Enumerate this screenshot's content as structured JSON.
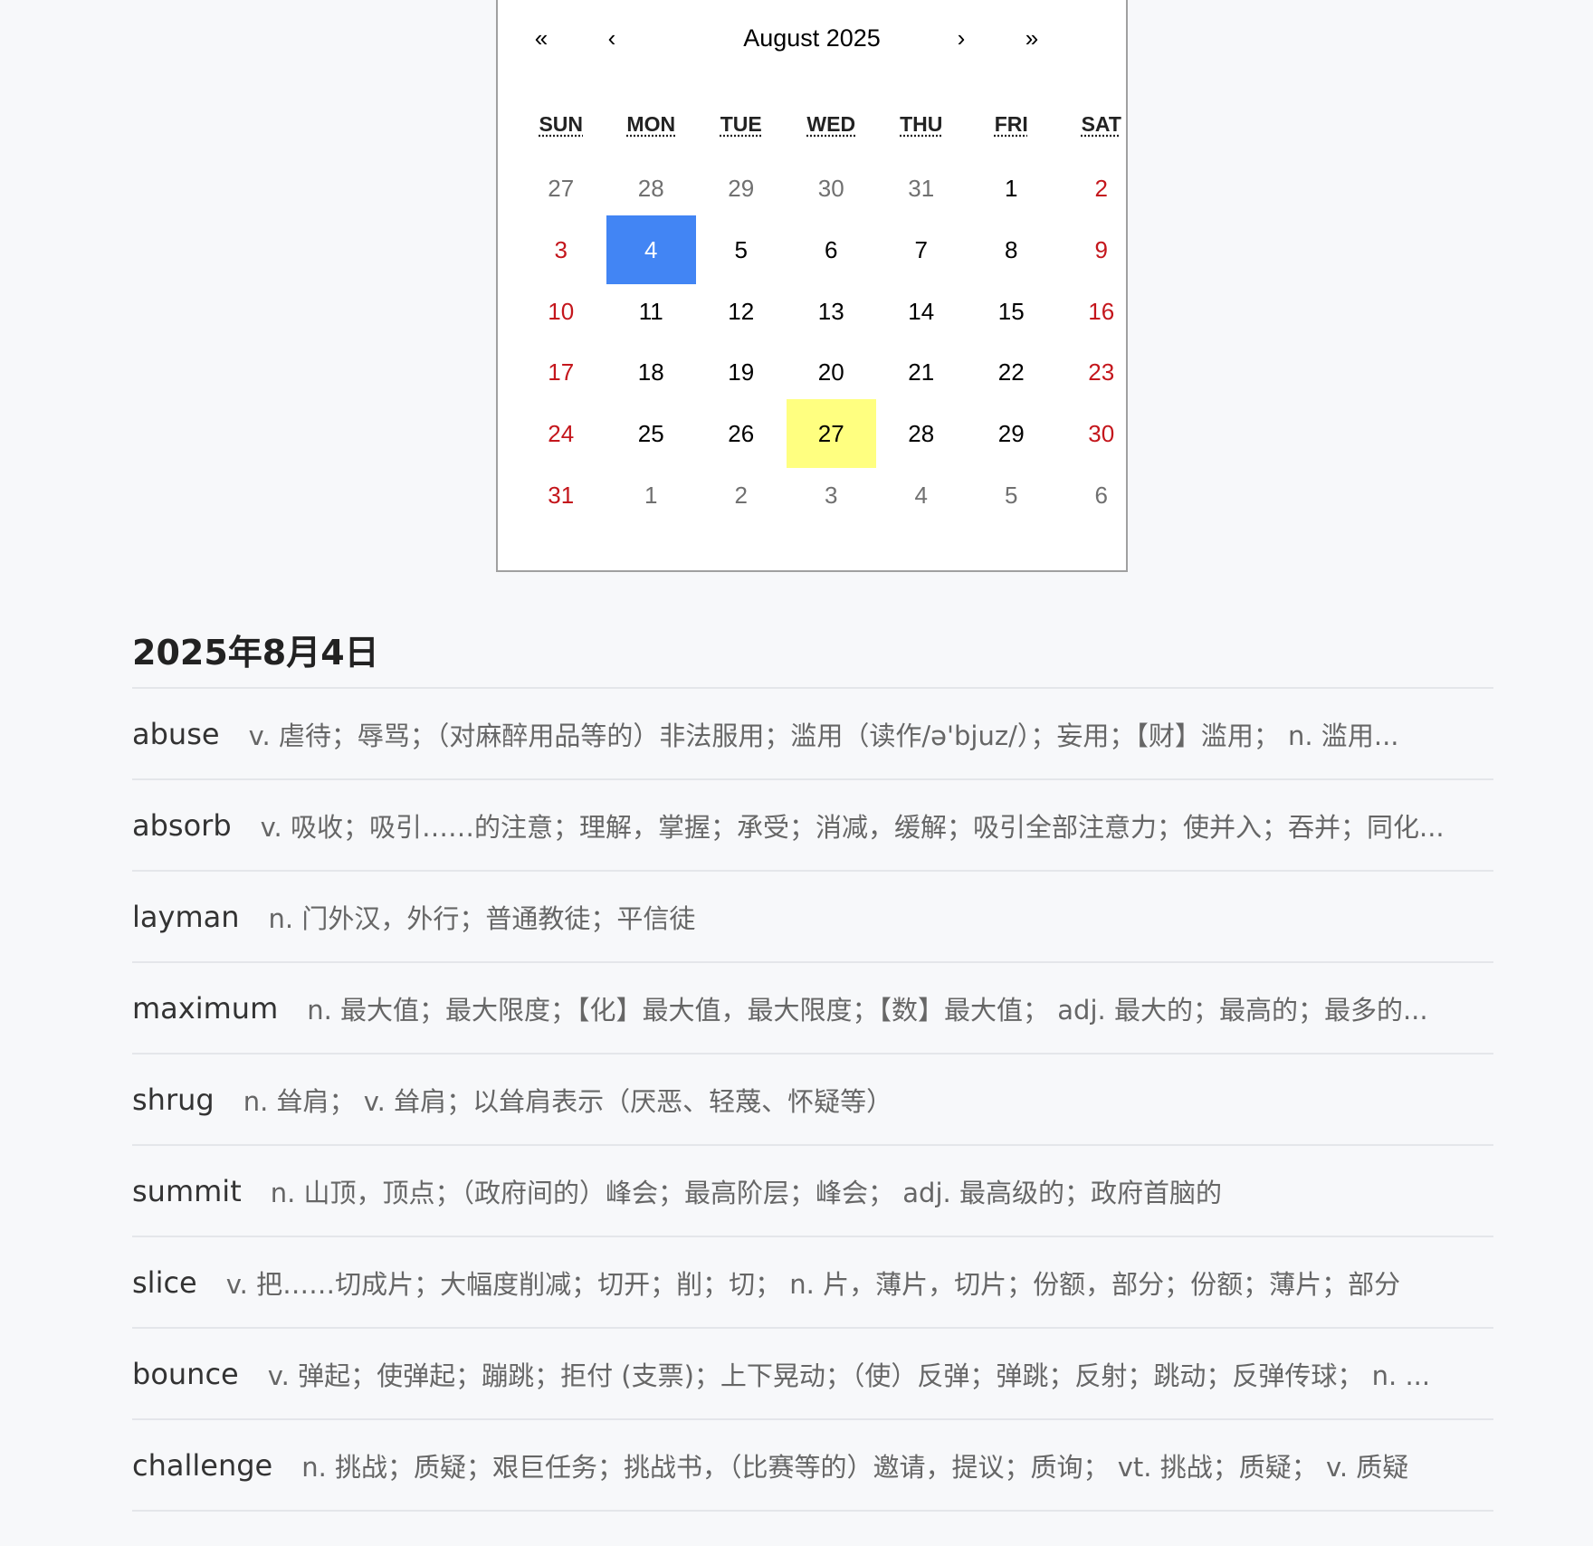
{
  "calendar": {
    "title": "August 2025",
    "nav": {
      "prev_year": "«",
      "prev_month": "‹",
      "next_month": "›",
      "next_year": "»"
    },
    "weekdays": [
      "SUN",
      "MON",
      "TUE",
      "WED",
      "THU",
      "FRI",
      "SAT"
    ],
    "weeks": [
      [
        {
          "n": "27",
          "state": "other"
        },
        {
          "n": "28",
          "state": "other"
        },
        {
          "n": "29",
          "state": "other"
        },
        {
          "n": "30",
          "state": "other"
        },
        {
          "n": "31",
          "state": "other"
        },
        {
          "n": "1",
          "state": "normal"
        },
        {
          "n": "2",
          "state": "weekend"
        }
      ],
      [
        {
          "n": "3",
          "state": "weekend"
        },
        {
          "n": "4",
          "state": "selected"
        },
        {
          "n": "5",
          "state": "normal"
        },
        {
          "n": "6",
          "state": "normal"
        },
        {
          "n": "7",
          "state": "normal"
        },
        {
          "n": "8",
          "state": "normal"
        },
        {
          "n": "9",
          "state": "weekend"
        }
      ],
      [
        {
          "n": "10",
          "state": "weekend"
        },
        {
          "n": "11",
          "state": "normal"
        },
        {
          "n": "12",
          "state": "normal"
        },
        {
          "n": "13",
          "state": "normal"
        },
        {
          "n": "14",
          "state": "normal"
        },
        {
          "n": "15",
          "state": "normal"
        },
        {
          "n": "16",
          "state": "weekend"
        }
      ],
      [
        {
          "n": "17",
          "state": "weekend"
        },
        {
          "n": "18",
          "state": "normal"
        },
        {
          "n": "19",
          "state": "normal"
        },
        {
          "n": "20",
          "state": "normal"
        },
        {
          "n": "21",
          "state": "normal"
        },
        {
          "n": "22",
          "state": "normal"
        },
        {
          "n": "23",
          "state": "weekend"
        }
      ],
      [
        {
          "n": "24",
          "state": "weekend"
        },
        {
          "n": "25",
          "state": "normal"
        },
        {
          "n": "26",
          "state": "normal"
        },
        {
          "n": "27",
          "state": "today"
        },
        {
          "n": "28",
          "state": "normal"
        },
        {
          "n": "29",
          "state": "normal"
        },
        {
          "n": "30",
          "state": "weekend"
        }
      ],
      [
        {
          "n": "31",
          "state": "weekend"
        },
        {
          "n": "1",
          "state": "other"
        },
        {
          "n": "2",
          "state": "other"
        },
        {
          "n": "3",
          "state": "other"
        },
        {
          "n": "4",
          "state": "other"
        },
        {
          "n": "5",
          "state": "other"
        },
        {
          "n": "6",
          "state": "other"
        }
      ]
    ],
    "colors": {
      "selected": "#4285f4",
      "today": "#ffff80",
      "weekend": "#c4161c",
      "other_month": "#707070"
    }
  },
  "date_heading": "2025年8月4日",
  "words": [
    {
      "word": "abuse",
      "definition": "v. 虐待；辱骂；（对麻醉用品等的）非法服用；滥用（读作/ə'bjuz/）；妄用；【财】滥用； n. 滥用..."
    },
    {
      "word": "absorb",
      "definition": "v. 吸收；吸引……的注意；理解，掌握；承受；消减，缓解；吸引全部注意力；使并入；吞并；同化..."
    },
    {
      "word": "layman",
      "definition": "n. 门外汉，外行；普通教徒；平信徒"
    },
    {
      "word": "maximum",
      "definition": "n. 最大值；最大限度；【化】最大值，最大限度；【数】最大值； adj. 最大的；最高的；最多的..."
    },
    {
      "word": "shrug",
      "definition": "n. 耸肩； v. 耸肩；以耸肩表示（厌恶、轻蔑、怀疑等）"
    },
    {
      "word": "summit",
      "definition": "n. 山顶，顶点；（政府间的）峰会；最高阶层；峰会； adj. 最高级的；政府首脑的"
    },
    {
      "word": "slice",
      "definition": "v. 把……切成片；大幅度削减；切开；削；切； n. 片，薄片，切片；份额，部分；份额；薄片；部分"
    },
    {
      "word": "bounce",
      "definition": "v. 弹起；使弹起；蹦跳；拒付 (支票)；上下晃动；（使）反弹；弹跳；反射；跳动；反弹传球； n. ..."
    },
    {
      "word": "challenge",
      "definition": "n. 挑战；质疑；艰巨任务；挑战书，（比赛等的）邀请，提议；质询； vt. 挑战；质疑； v. 质疑"
    }
  ]
}
